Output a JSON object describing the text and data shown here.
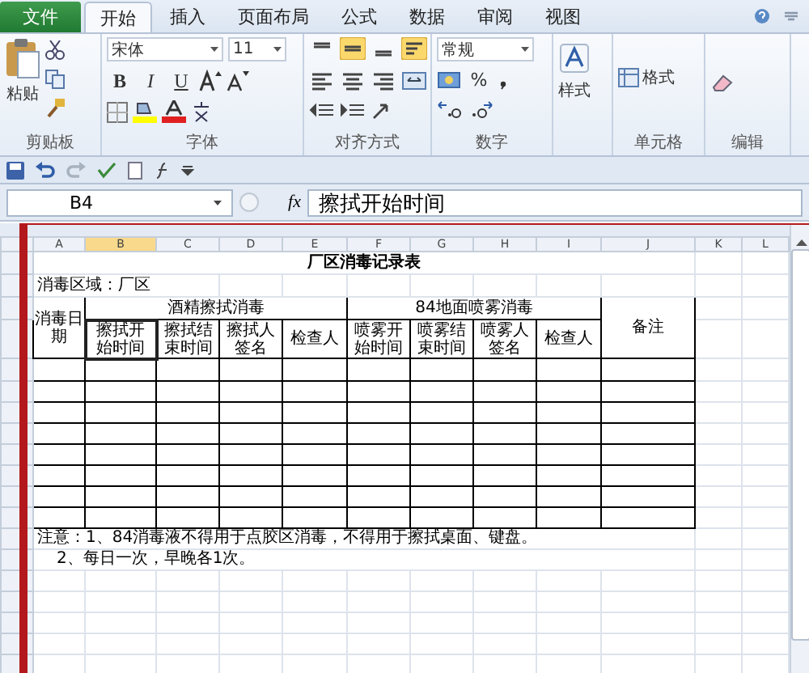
{
  "ribbon_tabs": [
    {
      "label": "文件",
      "kind": "file",
      "selected": false
    },
    {
      "label": "开始",
      "kind": "tab",
      "selected": true
    },
    {
      "label": "插入",
      "kind": "tab",
      "selected": false
    },
    {
      "label": "页面布局",
      "kind": "tab",
      "selected": false
    },
    {
      "label": "公式",
      "kind": "tab",
      "selected": false
    },
    {
      "label": "数据",
      "kind": "tab",
      "selected": false
    },
    {
      "label": "审阅",
      "kind": "tab",
      "selected": false
    },
    {
      "label": "视图",
      "kind": "tab",
      "selected": false
    }
  ],
  "ribbon": {
    "clipboard": {
      "paste_label": "粘贴",
      "group_label": "剪贴板"
    },
    "font": {
      "name": "宋体",
      "size": "11",
      "format_buttons": [
        "B",
        "I",
        "U"
      ],
      "group_label": "字体"
    },
    "alignment": {
      "group_label": "对齐方式"
    },
    "number": {
      "format": "常规",
      "percent": "%",
      "group_label": "数字"
    },
    "styles": {
      "label": "样式"
    },
    "cells": {
      "format_label": "格式",
      "group_label": "单元格"
    },
    "editing": {
      "group_label": "编辑"
    }
  },
  "formula_bar": {
    "name_box": "B4",
    "function_label": "fx",
    "content": "擦拭开始时间"
  },
  "sheet": {
    "columns": [
      {
        "label": "A",
        "selected": false
      },
      {
        "label": "B",
        "selected": true
      },
      {
        "label": "C",
        "selected": false
      },
      {
        "label": "D",
        "selected": false
      },
      {
        "label": "E",
        "selected": false
      },
      {
        "label": "F",
        "selected": false
      },
      {
        "label": "G",
        "selected": false
      },
      {
        "label": "H",
        "selected": false
      },
      {
        "label": "I",
        "selected": false
      },
      {
        "label": "J",
        "selected": false
      },
      {
        "label": "K",
        "selected": false
      },
      {
        "label": "L",
        "selected": false
      }
    ],
    "title": "厂区消毒记录表",
    "area": "消毒区域：厂区",
    "date_header": "消毒日期",
    "groups": [
      "酒精擦拭消毒",
      "84地面喷雾消毒"
    ],
    "sub_headers": [
      "擦拭开始时间",
      "擦拭结束时间",
      "擦拭人签名",
      "检查人",
      "喷雾开始时间",
      "喷雾结束时间",
      "喷雾人签名",
      "检查人"
    ],
    "remark_header": "备注",
    "notes": [
      "注意：1、84消毒液不得用于点胶区消毒，不得用于擦拭桌面、键盘。",
      "2、每日一次，早晚各1次。"
    ]
  }
}
